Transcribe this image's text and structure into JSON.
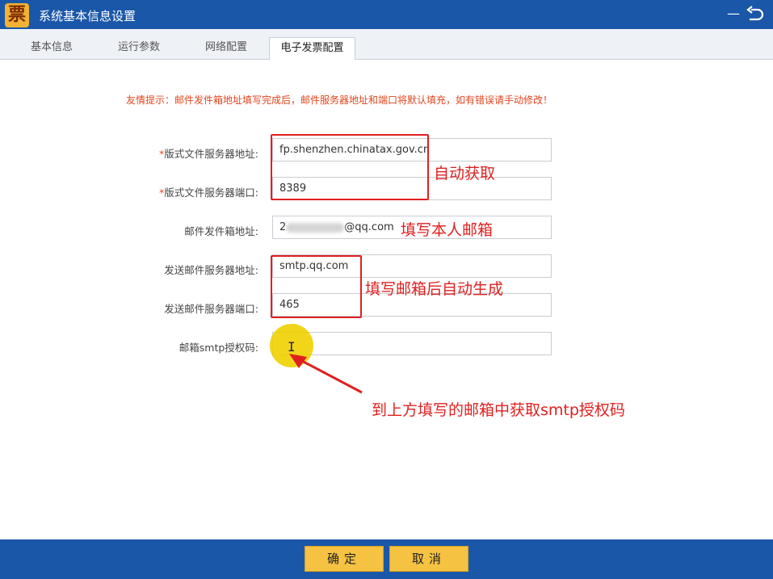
{
  "window": {
    "title": "系统基本信息设置",
    "logo_glyph": "票"
  },
  "tabs": [
    {
      "label": "基本信息"
    },
    {
      "label": "运行参数"
    },
    {
      "label": "网络配置"
    },
    {
      "label": "电子发票配置",
      "active": true
    }
  ],
  "tip": "友情提示：邮件发件箱地址填写完成后，邮件服务器地址和端口将默认填充，如有错误请手动修改！",
  "form": {
    "rows": [
      {
        "label": "版式文件服务器地址:",
        "required": true,
        "value": "fp.shenzhen.chinatax.gov.cn"
      },
      {
        "label": "版式文件服务器端口:",
        "required": true,
        "value": "8389"
      },
      {
        "label": "邮件发件箱地址:",
        "required": false,
        "value_prefix": "2",
        "value_suffix": "@qq.com"
      },
      {
        "label": "发送邮件服务器地址:",
        "required": false,
        "value": "smtp.qq.com"
      },
      {
        "label": "发送邮件服务器端口:",
        "required": false,
        "value": "465"
      },
      {
        "label": "邮箱smtp授权码:",
        "required": false,
        "value": ""
      }
    ],
    "required_mark": "*"
  },
  "annotations": {
    "auto_fetch": "自动获取",
    "fill_email": "填写本人邮箱",
    "auto_generate": "填写邮箱后自动生成",
    "get_smtp": "到上方填写的邮箱中获取smtp授权码",
    "color": "#e02020"
  },
  "footer": {
    "ok_label": "确定",
    "cancel_label": "取消"
  },
  "colors": {
    "titlebar": "#1b57a8",
    "button": "#f5c242",
    "tip": "#e0461f"
  }
}
